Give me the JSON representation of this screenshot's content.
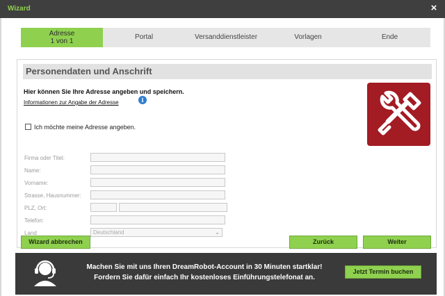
{
  "window": {
    "title": "Wizard",
    "close_glyph": "×"
  },
  "steps": [
    {
      "label": "Adresse",
      "sub": "1 von 1",
      "active": true
    },
    {
      "label": "Portal",
      "active": false
    },
    {
      "label": "Versanddienstleister",
      "active": false
    },
    {
      "label": "Vorlagen",
      "active": false
    },
    {
      "label": "Ende",
      "active": false
    }
  ],
  "panel": {
    "heading": "Personendaten und Anschrift",
    "intro": "Hier können Sie Ihre Adresse angeben und speichern.",
    "info_link": "Informationen zur Angabe der Adresse",
    "info_icon": "info-icon",
    "tools_icon": "wrench-screwdriver-icon",
    "checkbox_label": "Ich möchte meine Adresse angeben.",
    "checkbox_checked": false,
    "fields": {
      "firma": {
        "label": "Firma oder Titel:",
        "value": ""
      },
      "name": {
        "label": "Name:",
        "value": ""
      },
      "vorname": {
        "label": "Vorname:",
        "value": ""
      },
      "strasse": {
        "label": "Strasse, Hausnummer:",
        "value": ""
      },
      "plz_ort": {
        "label": "PLZ, Ort:",
        "plz_value": "",
        "ort_value": ""
      },
      "telefon": {
        "label": "Telefon:",
        "value": ""
      },
      "land": {
        "label": "Land",
        "selected": "Deutschland"
      }
    }
  },
  "buttons": {
    "cancel": "Wizard abbrechen",
    "back": "Zurück",
    "next": "Weiter"
  },
  "banner": {
    "line1": "Machen Sie mit uns Ihren DreamRobot-Account in 30 Minuten startklar!",
    "line2": "Fordern Sie dafür einfach Ihr kostenloses Einführungstelefonat an.",
    "cta": "Jetzt Termin buchen",
    "icon": "headset-icon"
  },
  "colors": {
    "accent": "#8fd14f",
    "titlebar": "#3f3f3f",
    "tool_icon_bg": "#a31b23",
    "banner_bg": "#3a3a3a"
  }
}
